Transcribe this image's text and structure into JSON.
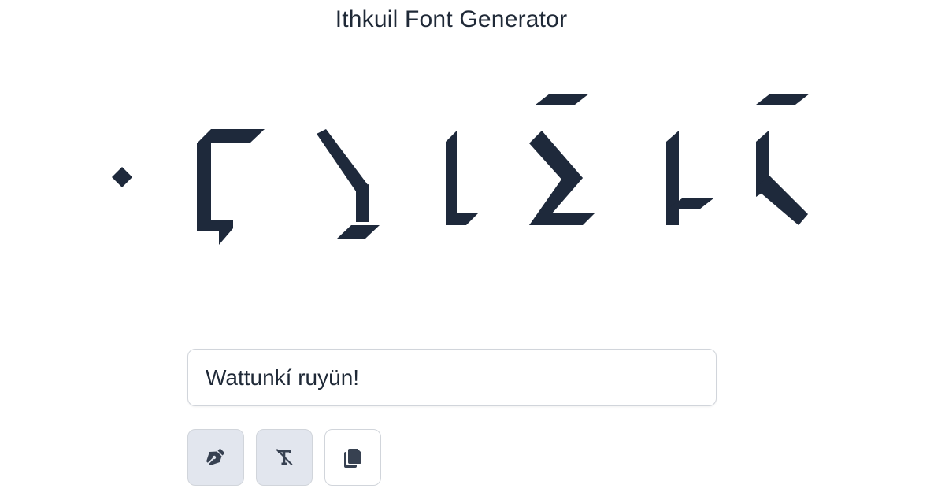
{
  "app": {
    "title": "Ithkuil Font Generator"
  },
  "input": {
    "value": "Wattunkí ruyün!"
  },
  "toolbar": {
    "buttons": [
      {
        "icon": "pen-nib-icon",
        "label": "Draw",
        "active": true
      },
      {
        "icon": "text-slash-icon",
        "label": "Clear formatting",
        "active": true
      },
      {
        "icon": "copy-icon",
        "label": "Copy",
        "active": false
      }
    ]
  },
  "colors": {
    "glyph": "#1e293b",
    "text": "#1f2937",
    "border": "#d1d5db",
    "button_active_bg": "#e2e6ee"
  }
}
